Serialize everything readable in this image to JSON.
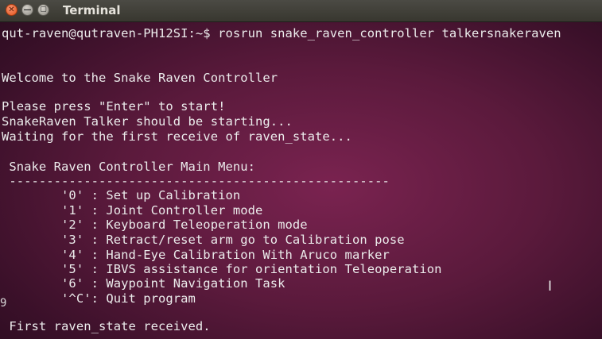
{
  "window": {
    "title": "Terminal",
    "close_glyph": "✕",
    "min_glyph": "—",
    "max_glyph": "▢"
  },
  "terminal": {
    "prompt": "qut-raven@qutraven-PH12SI:~$ rosrun snake_raven_controller talkersnakeraven",
    "welcome": "Welcome to the Snake Raven Controller",
    "press_enter": "Please press \"Enter\" to start!",
    "talker_starting": "SnakeRaven Talker should be starting...",
    "waiting": "Waiting for the first receive of raven_state...",
    "menu_title": " Snake Raven Controller Main Menu:",
    "divider": " ---------------------------------------------------",
    "menu_items": [
      "        '0' : Set up Calibration",
      "        '1' : Joint Controller mode",
      "        '2' : Keyboard Teleoperation mode",
      "        '3' : Retract/reset arm go to Calibration pose",
      "        '4' : Hand-Eye Calibration With Aruco marker",
      "        '5' : IBVS assistance for orientation Teleoperation",
      "        '6' : Waypoint Navigation Task",
      "        '^C': Quit program"
    ],
    "received": " First raven_state received.",
    "stray_char": "9",
    "ibeam_glyph": "I"
  },
  "colors": {
    "terminal_bg": "#5b1a3c",
    "terminal_text": "#ececec",
    "titlebar": "#3c3b37",
    "close_button": "#e2551c"
  }
}
